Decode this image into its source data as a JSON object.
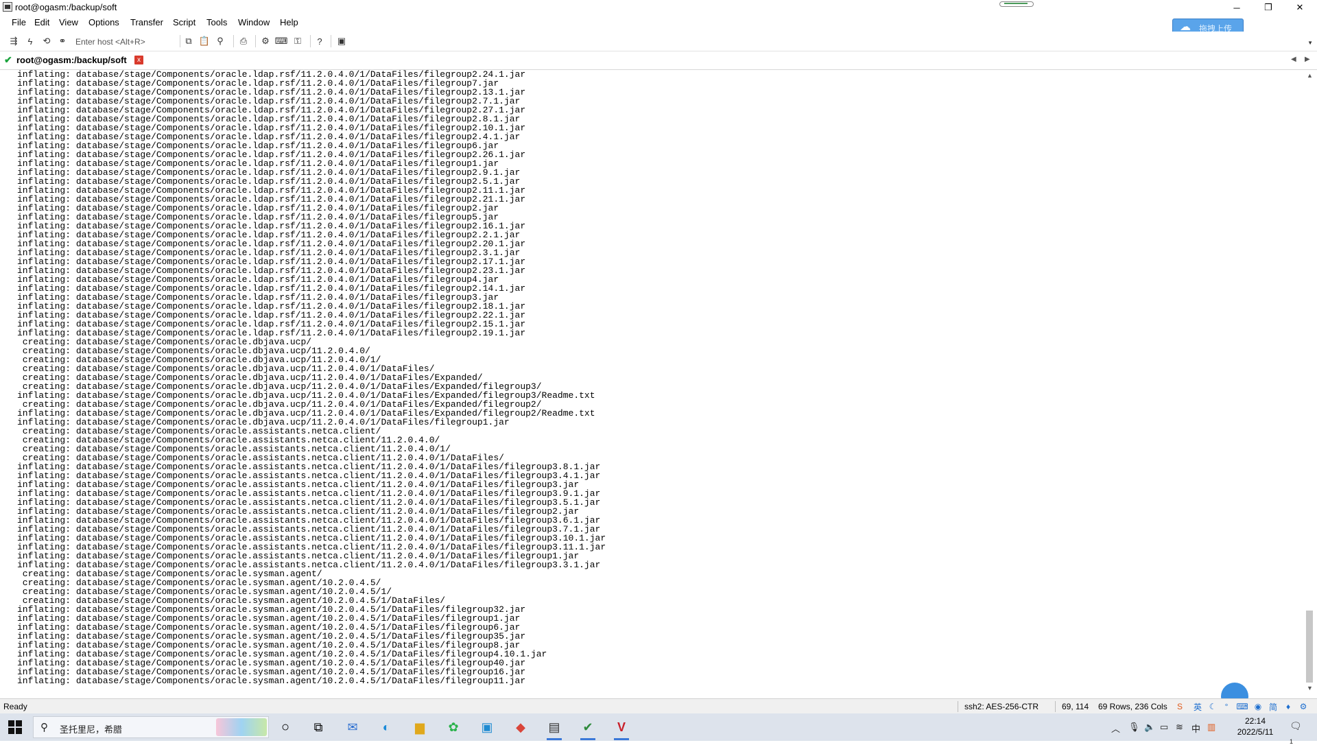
{
  "window": {
    "title": "root@ogasm:/backup/soft",
    "controls": {
      "minimize": "─",
      "maximize": "❐",
      "close": "✕"
    }
  },
  "menubar": {
    "items": [
      "File",
      "Edit",
      "View",
      "Options",
      "Transfer",
      "Script",
      "Tools",
      "Window",
      "Help"
    ]
  },
  "upload_button": {
    "label": "拖拽上传"
  },
  "toolbar": {
    "host_placeholder": "Enter host <Alt+R>"
  },
  "tab": {
    "label": "root@ogasm:/backup/soft",
    "close_glyph": "x"
  },
  "terminal": {
    "lines": [
      "inflating: database/stage/Components/oracle.ldap.rsf/11.2.0.4.0/1/DataFiles/filegroup2.24.1.jar",
      "inflating: database/stage/Components/oracle.ldap.rsf/11.2.0.4.0/1/DataFiles/filegroup7.jar",
      "inflating: database/stage/Components/oracle.ldap.rsf/11.2.0.4.0/1/DataFiles/filegroup2.13.1.jar",
      "inflating: database/stage/Components/oracle.ldap.rsf/11.2.0.4.0/1/DataFiles/filegroup2.7.1.jar",
      "inflating: database/stage/Components/oracle.ldap.rsf/11.2.0.4.0/1/DataFiles/filegroup2.27.1.jar",
      "inflating: database/stage/Components/oracle.ldap.rsf/11.2.0.4.0/1/DataFiles/filegroup2.8.1.jar",
      "inflating: database/stage/Components/oracle.ldap.rsf/11.2.0.4.0/1/DataFiles/filegroup2.10.1.jar",
      "inflating: database/stage/Components/oracle.ldap.rsf/11.2.0.4.0/1/DataFiles/filegroup2.4.1.jar",
      "inflating: database/stage/Components/oracle.ldap.rsf/11.2.0.4.0/1/DataFiles/filegroup6.jar",
      "inflating: database/stage/Components/oracle.ldap.rsf/11.2.0.4.0/1/DataFiles/filegroup2.26.1.jar",
      "inflating: database/stage/Components/oracle.ldap.rsf/11.2.0.4.0/1/DataFiles/filegroup1.jar",
      "inflating: database/stage/Components/oracle.ldap.rsf/11.2.0.4.0/1/DataFiles/filegroup2.9.1.jar",
      "inflating: database/stage/Components/oracle.ldap.rsf/11.2.0.4.0/1/DataFiles/filegroup2.5.1.jar",
      "inflating: database/stage/Components/oracle.ldap.rsf/11.2.0.4.0/1/DataFiles/filegroup2.11.1.jar",
      "inflating: database/stage/Components/oracle.ldap.rsf/11.2.0.4.0/1/DataFiles/filegroup2.21.1.jar",
      "inflating: database/stage/Components/oracle.ldap.rsf/11.2.0.4.0/1/DataFiles/filegroup2.jar",
      "inflating: database/stage/Components/oracle.ldap.rsf/11.2.0.4.0/1/DataFiles/filegroup5.jar",
      "inflating: database/stage/Components/oracle.ldap.rsf/11.2.0.4.0/1/DataFiles/filegroup2.16.1.jar",
      "inflating: database/stage/Components/oracle.ldap.rsf/11.2.0.4.0/1/DataFiles/filegroup2.2.1.jar",
      "inflating: database/stage/Components/oracle.ldap.rsf/11.2.0.4.0/1/DataFiles/filegroup2.20.1.jar",
      "inflating: database/stage/Components/oracle.ldap.rsf/11.2.0.4.0/1/DataFiles/filegroup2.3.1.jar",
      "inflating: database/stage/Components/oracle.ldap.rsf/11.2.0.4.0/1/DataFiles/filegroup2.17.1.jar",
      "inflating: database/stage/Components/oracle.ldap.rsf/11.2.0.4.0/1/DataFiles/filegroup2.23.1.jar",
      "inflating: database/stage/Components/oracle.ldap.rsf/11.2.0.4.0/1/DataFiles/filegroup4.jar",
      "inflating: database/stage/Components/oracle.ldap.rsf/11.2.0.4.0/1/DataFiles/filegroup2.14.1.jar",
      "inflating: database/stage/Components/oracle.ldap.rsf/11.2.0.4.0/1/DataFiles/filegroup3.jar",
      "inflating: database/stage/Components/oracle.ldap.rsf/11.2.0.4.0/1/DataFiles/filegroup2.18.1.jar",
      "inflating: database/stage/Components/oracle.ldap.rsf/11.2.0.4.0/1/DataFiles/filegroup2.22.1.jar",
      "inflating: database/stage/Components/oracle.ldap.rsf/11.2.0.4.0/1/DataFiles/filegroup2.15.1.jar",
      "inflating: database/stage/Components/oracle.ldap.rsf/11.2.0.4.0/1/DataFiles/filegroup2.19.1.jar",
      " creating: database/stage/Components/oracle.dbjava.ucp/",
      " creating: database/stage/Components/oracle.dbjava.ucp/11.2.0.4.0/",
      " creating: database/stage/Components/oracle.dbjava.ucp/11.2.0.4.0/1/",
      " creating: database/stage/Components/oracle.dbjava.ucp/11.2.0.4.0/1/DataFiles/",
      " creating: database/stage/Components/oracle.dbjava.ucp/11.2.0.4.0/1/DataFiles/Expanded/",
      " creating: database/stage/Components/oracle.dbjava.ucp/11.2.0.4.0/1/DataFiles/Expanded/filegroup3/",
      "inflating: database/stage/Components/oracle.dbjava.ucp/11.2.0.4.0/1/DataFiles/Expanded/filegroup3/Readme.txt",
      " creating: database/stage/Components/oracle.dbjava.ucp/11.2.0.4.0/1/DataFiles/Expanded/filegroup2/",
      "inflating: database/stage/Components/oracle.dbjava.ucp/11.2.0.4.0/1/DataFiles/Expanded/filegroup2/Readme.txt",
      "inflating: database/stage/Components/oracle.dbjava.ucp/11.2.0.4.0/1/DataFiles/filegroup1.jar",
      " creating: database/stage/Components/oracle.assistants.netca.client/",
      " creating: database/stage/Components/oracle.assistants.netca.client/11.2.0.4.0/",
      " creating: database/stage/Components/oracle.assistants.netca.client/11.2.0.4.0/1/",
      " creating: database/stage/Components/oracle.assistants.netca.client/11.2.0.4.0/1/DataFiles/",
      "inflating: database/stage/Components/oracle.assistants.netca.client/11.2.0.4.0/1/DataFiles/filegroup3.8.1.jar",
      "inflating: database/stage/Components/oracle.assistants.netca.client/11.2.0.4.0/1/DataFiles/filegroup3.4.1.jar",
      "inflating: database/stage/Components/oracle.assistants.netca.client/11.2.0.4.0/1/DataFiles/filegroup3.jar",
      "inflating: database/stage/Components/oracle.assistants.netca.client/11.2.0.4.0/1/DataFiles/filegroup3.9.1.jar",
      "inflating: database/stage/Components/oracle.assistants.netca.client/11.2.0.4.0/1/DataFiles/filegroup3.5.1.jar",
      "inflating: database/stage/Components/oracle.assistants.netca.client/11.2.0.4.0/1/DataFiles/filegroup2.jar",
      "inflating: database/stage/Components/oracle.assistants.netca.client/11.2.0.4.0/1/DataFiles/filegroup3.6.1.jar",
      "inflating: database/stage/Components/oracle.assistants.netca.client/11.2.0.4.0/1/DataFiles/filegroup3.7.1.jar",
      "inflating: database/stage/Components/oracle.assistants.netca.client/11.2.0.4.0/1/DataFiles/filegroup3.10.1.jar",
      "inflating: database/stage/Components/oracle.assistants.netca.client/11.2.0.4.0/1/DataFiles/filegroup3.11.1.jar",
      "inflating: database/stage/Components/oracle.assistants.netca.client/11.2.0.4.0/1/DataFiles/filegroup1.jar",
      "inflating: database/stage/Components/oracle.assistants.netca.client/11.2.0.4.0/1/DataFiles/filegroup3.3.1.jar",
      " creating: database/stage/Components/oracle.sysman.agent/",
      " creating: database/stage/Components/oracle.sysman.agent/10.2.0.4.5/",
      " creating: database/stage/Components/oracle.sysman.agent/10.2.0.4.5/1/",
      " creating: database/stage/Components/oracle.sysman.agent/10.2.0.4.5/1/DataFiles/",
      "inflating: database/stage/Components/oracle.sysman.agent/10.2.0.4.5/1/DataFiles/filegroup32.jar",
      "inflating: database/stage/Components/oracle.sysman.agent/10.2.0.4.5/1/DataFiles/filegroup1.jar",
      "inflating: database/stage/Components/oracle.sysman.agent/10.2.0.4.5/1/DataFiles/filegroup6.jar",
      "inflating: database/stage/Components/oracle.sysman.agent/10.2.0.4.5/1/DataFiles/filegroup35.jar",
      "inflating: database/stage/Components/oracle.sysman.agent/10.2.0.4.5/1/DataFiles/filegroup8.jar",
      "inflating: database/stage/Components/oracle.sysman.agent/10.2.0.4.5/1/DataFiles/filegroup4.10.1.jar",
      "inflating: database/stage/Components/oracle.sysman.agent/10.2.0.4.5/1/DataFiles/filegroup40.jar",
      "inflating: database/stage/Components/oracle.sysman.agent/10.2.0.4.5/1/DataFiles/filegroup16.jar",
      "inflating: database/stage/Components/oracle.sysman.agent/10.2.0.4.5/1/DataFiles/filegroup11.jar"
    ]
  },
  "statusbar": {
    "ready": "Ready",
    "cipher": "ssh2: AES-256-CTR",
    "cursor": "69, 114",
    "size": "69 Rows, 236 Cols",
    "ime_lang": "英",
    "ime_simplified": "简"
  },
  "taskbar": {
    "search_text": "圣托里尼，希腊",
    "clock_time": "22:14",
    "clock_date": "2022/5/11",
    "notification_count": "1"
  }
}
